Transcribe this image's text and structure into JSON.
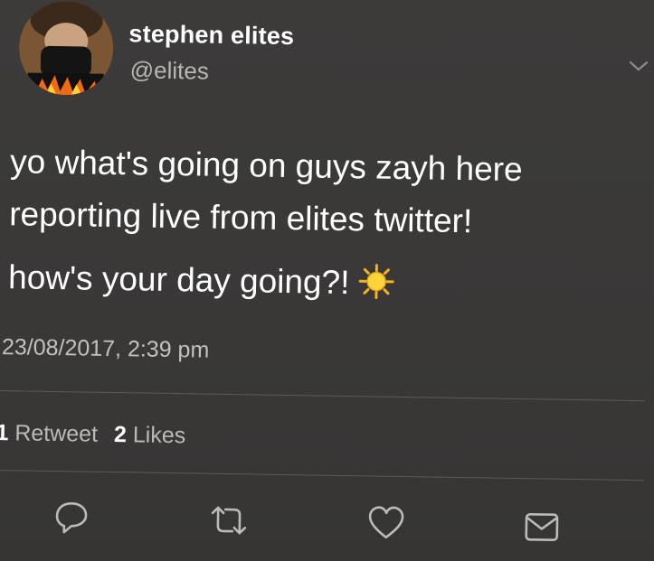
{
  "tweet": {
    "display_name": "stephen elites",
    "handle": "@elites",
    "text_line1": "yo what's going on guys zayh here reporting live from elites twitter!",
    "text_line2": "how's your day going?!",
    "timestamp": "23/08/2017, 2:39 pm",
    "retweets": {
      "count": "1",
      "label": "Retweet"
    },
    "likes": {
      "count": "2",
      "label": "Likes"
    }
  },
  "icons": {
    "more": "chevron-down-icon",
    "reply": "reply-icon",
    "retweet": "retweet-icon",
    "like": "heart-icon",
    "dm": "mail-icon",
    "emoji": "sun-emoji"
  },
  "colors": {
    "background": "#3a3938",
    "text": "#ffffff",
    "muted": "#b9b7b5",
    "divider": "#5c5a58",
    "icon": "#bdbbb9"
  }
}
